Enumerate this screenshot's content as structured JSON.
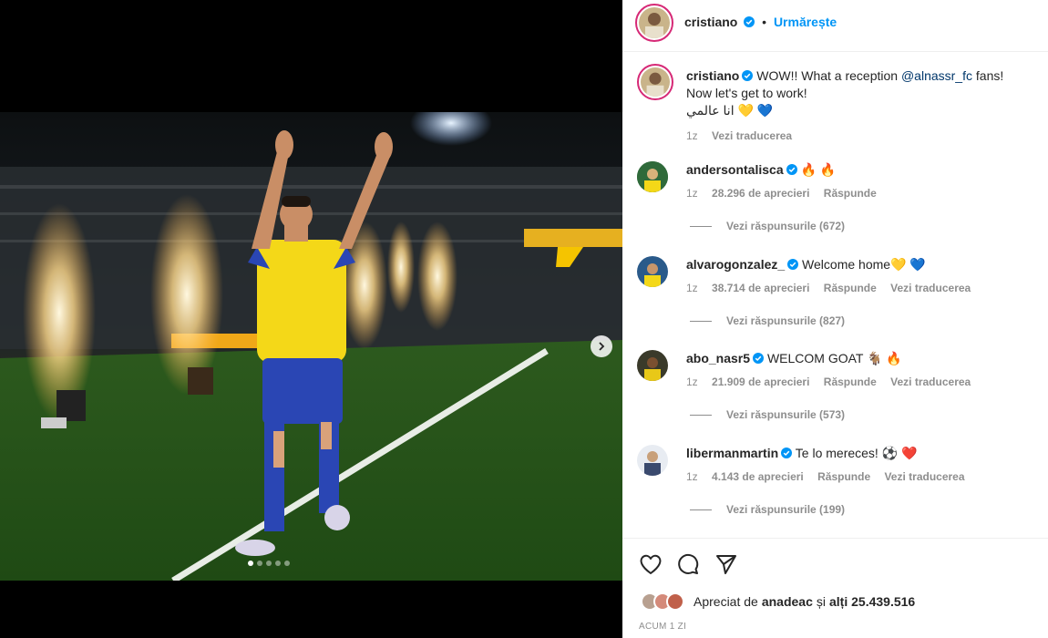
{
  "post": {
    "username": "cristiano",
    "follow_label": "Urmărește",
    "separator": "•",
    "caption_line1": "WOW!! What a reception",
    "caption_mention": "@alnassr_fc",
    "caption_line1_end": "fans!",
    "caption_line2": "Now let's get to work!",
    "caption_line3": "انا عالمي 💛 💙",
    "caption_age": "1z",
    "caption_translate": "Vezi traducerea"
  },
  "comments": [
    {
      "user": "andersontalisca",
      "text": "🔥 🔥",
      "age": "1z",
      "likes": "28.296 de aprecieri",
      "reply": "Răspunde",
      "translate": "",
      "replies": "Vezi răspunsurile (672)",
      "avatar_color": "#1e5a2e"
    },
    {
      "user": "alvarogonzalez_",
      "text": "Welcome home💛 💙",
      "age": "1z",
      "likes": "38.714 de aprecieri",
      "reply": "Răspunde",
      "translate": "Vezi traducerea",
      "replies": "Vezi răspunsurile (827)",
      "avatar_color": "#1d4d7a"
    },
    {
      "user": "abo_nasr5",
      "text": "WELCOM GOAT 🐐 🔥",
      "age": "1z",
      "likes": "21.909 de aprecieri",
      "reply": "Răspunde",
      "translate": "Vezi traducerea",
      "replies": "Vezi răspunsurile (573)",
      "avatar_color": "#3a3a2a"
    },
    {
      "user": "libermanmartin",
      "text": "Te lo mereces! ⚽ ❤️",
      "age": "1z",
      "likes": "4.143 de aprecieri",
      "reply": "Răspunde",
      "translate": "Vezi traducerea",
      "replies": "Vezi răspunsurile (199)",
      "avatar_color": "#6a7a8e"
    }
  ],
  "likes": {
    "prefix": "Apreciat de",
    "user": "anadeac",
    "and": "și",
    "others": "alți 25.439.516"
  },
  "timestamp": "ACUM 1 ZI",
  "carousel": {
    "count": 5,
    "active": 1
  },
  "colors": {
    "accent": "#0095f6",
    "verified": "#0095f6",
    "muted": "#8e8e8e"
  },
  "icons": [
    "heart-icon",
    "comment-icon",
    "share-icon",
    "verified-icon",
    "chevron-right-icon"
  ]
}
